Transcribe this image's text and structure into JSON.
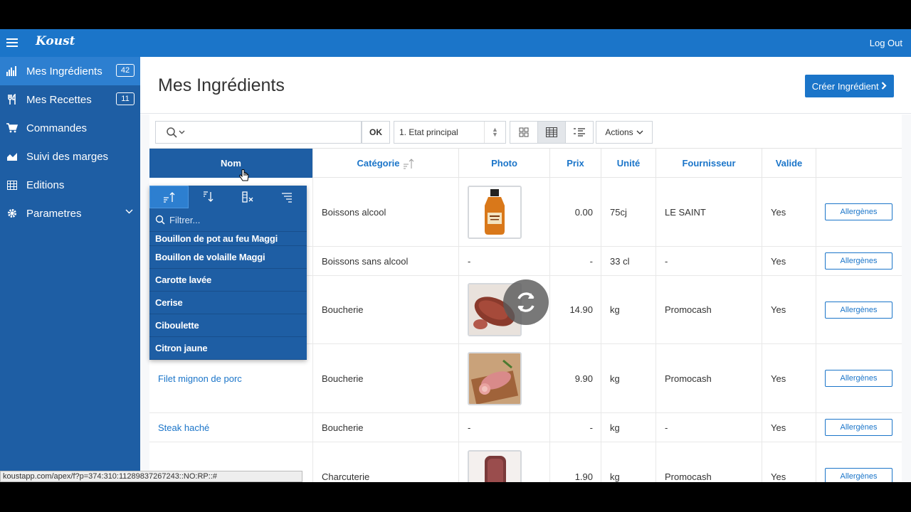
{
  "app": {
    "logo": "Koust",
    "logout": "Log Out"
  },
  "sidebar": {
    "items": [
      {
        "label": "Mes Ingrédients",
        "badge": "42"
      },
      {
        "label": "Mes Recettes",
        "badge": "11"
      },
      {
        "label": "Commandes"
      },
      {
        "label": "Suivi des marges"
      },
      {
        "label": "Editions"
      },
      {
        "label": "Parametres"
      }
    ]
  },
  "page": {
    "title": "Mes Ingrédients",
    "create_button": "Créer Ingrédient"
  },
  "toolbar": {
    "ok": "OK",
    "report_select": "1. Etat principal",
    "actions": "Actions"
  },
  "table": {
    "columns": [
      "Nom",
      "Catégorie",
      "Photo",
      "Prix",
      "Unité",
      "Fournisseur",
      "Valide"
    ],
    "allergen_label": "Allergènes",
    "rows": [
      {
        "nom": "",
        "categorie": "Boissons alcool",
        "photo": "bottle",
        "prix": "0.00",
        "unite": "75cj",
        "fournisseur": "LE SAINT",
        "valide": "Yes"
      },
      {
        "nom": "",
        "categorie": "Boissons sans alcool",
        "photo": "-",
        "prix": "-",
        "unite": "33 cl",
        "fournisseur": "-",
        "valide": "Yes"
      },
      {
        "nom": "",
        "categorie": "Boucherie",
        "photo": "meat",
        "prix": "14.90",
        "unite": "kg",
        "fournisseur": "Promocash",
        "valide": "Yes"
      },
      {
        "nom": "Filet mignon de porc",
        "categorie": "Boucherie",
        "photo": "pork",
        "prix": "9.90",
        "unite": "kg",
        "fournisseur": "Promocash",
        "valide": "Yes"
      },
      {
        "nom": "Steak haché",
        "categorie": "Boucherie",
        "photo": "-",
        "prix": "-",
        "unite": "kg",
        "fournisseur": "-",
        "valide": "Yes"
      },
      {
        "nom": "",
        "categorie": "Charcuterie",
        "photo": "sausage",
        "prix": "1.90",
        "unite": "kg",
        "fournisseur": "Promocash",
        "valide": "Yes"
      }
    ]
  },
  "dropdown": {
    "filter_placeholder": "Filtrer...",
    "items": [
      "Bouillon de pot au feu Maggi",
      "Bouillon de volaille Maggi",
      "Carotte lavée",
      "Cerise",
      "Ciboulette",
      "Citron jaune"
    ]
  },
  "statusbar": {
    "url": "koustapp.com/apex/f?p=374:310:11289837267243::NO:RP::#"
  },
  "colors": {
    "primary": "#1b75c9",
    "sidebar": "#1e5ea4",
    "sidebar_active": "#2d7fd0"
  }
}
